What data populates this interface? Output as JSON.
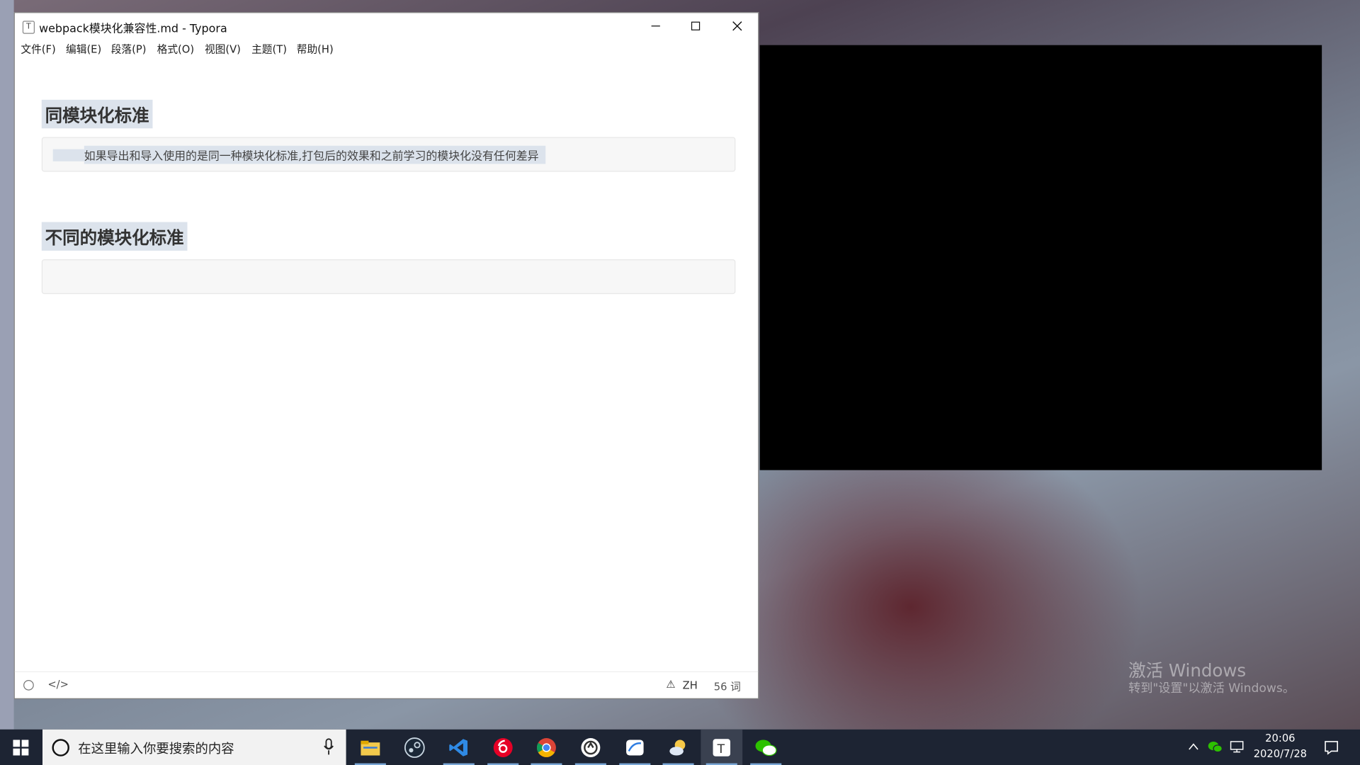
{
  "window": {
    "title": "webpack模块化兼容性.md - Typora",
    "app_icon_letter": "T"
  },
  "menu": [
    {
      "label": "文件(F)"
    },
    {
      "label": "编辑(E)"
    },
    {
      "label": "段落(P)"
    },
    {
      "label": "格式(O)"
    },
    {
      "label": "视图(V)"
    },
    {
      "label": "主题(T)"
    },
    {
      "label": "帮助(H)"
    }
  ],
  "document": {
    "heading1": "同模块化标准",
    "code1": "如果导出和导入使用的是同一种模块化标准,打包后的效果和之前学习的模块化没有任何差异",
    "heading2": "不同的模块化标准",
    "code2": ""
  },
  "statusbar": {
    "source_icon": "</>",
    "warning_icon": "⚠",
    "language": "ZH",
    "word_count": "56 词"
  },
  "desktop": {
    "watermark_title": "激活 Windows",
    "watermark_sub": "转到\"设置\"以激活 Windows。"
  },
  "taskbar": {
    "search_placeholder": "在这里输入你要搜索的内容",
    "apps": [
      "file-explorer",
      "steam",
      "vscode",
      "netease-music",
      "chrome",
      "app-circle",
      "pen-app",
      "weather-app",
      "typora",
      "wechat"
    ],
    "clock_time": "20:06",
    "clock_date": "2020/7/28"
  },
  "colors": {
    "selection": "#dce3ec",
    "taskbar": "#1d2433",
    "code_bg": "#f7f7f7"
  }
}
